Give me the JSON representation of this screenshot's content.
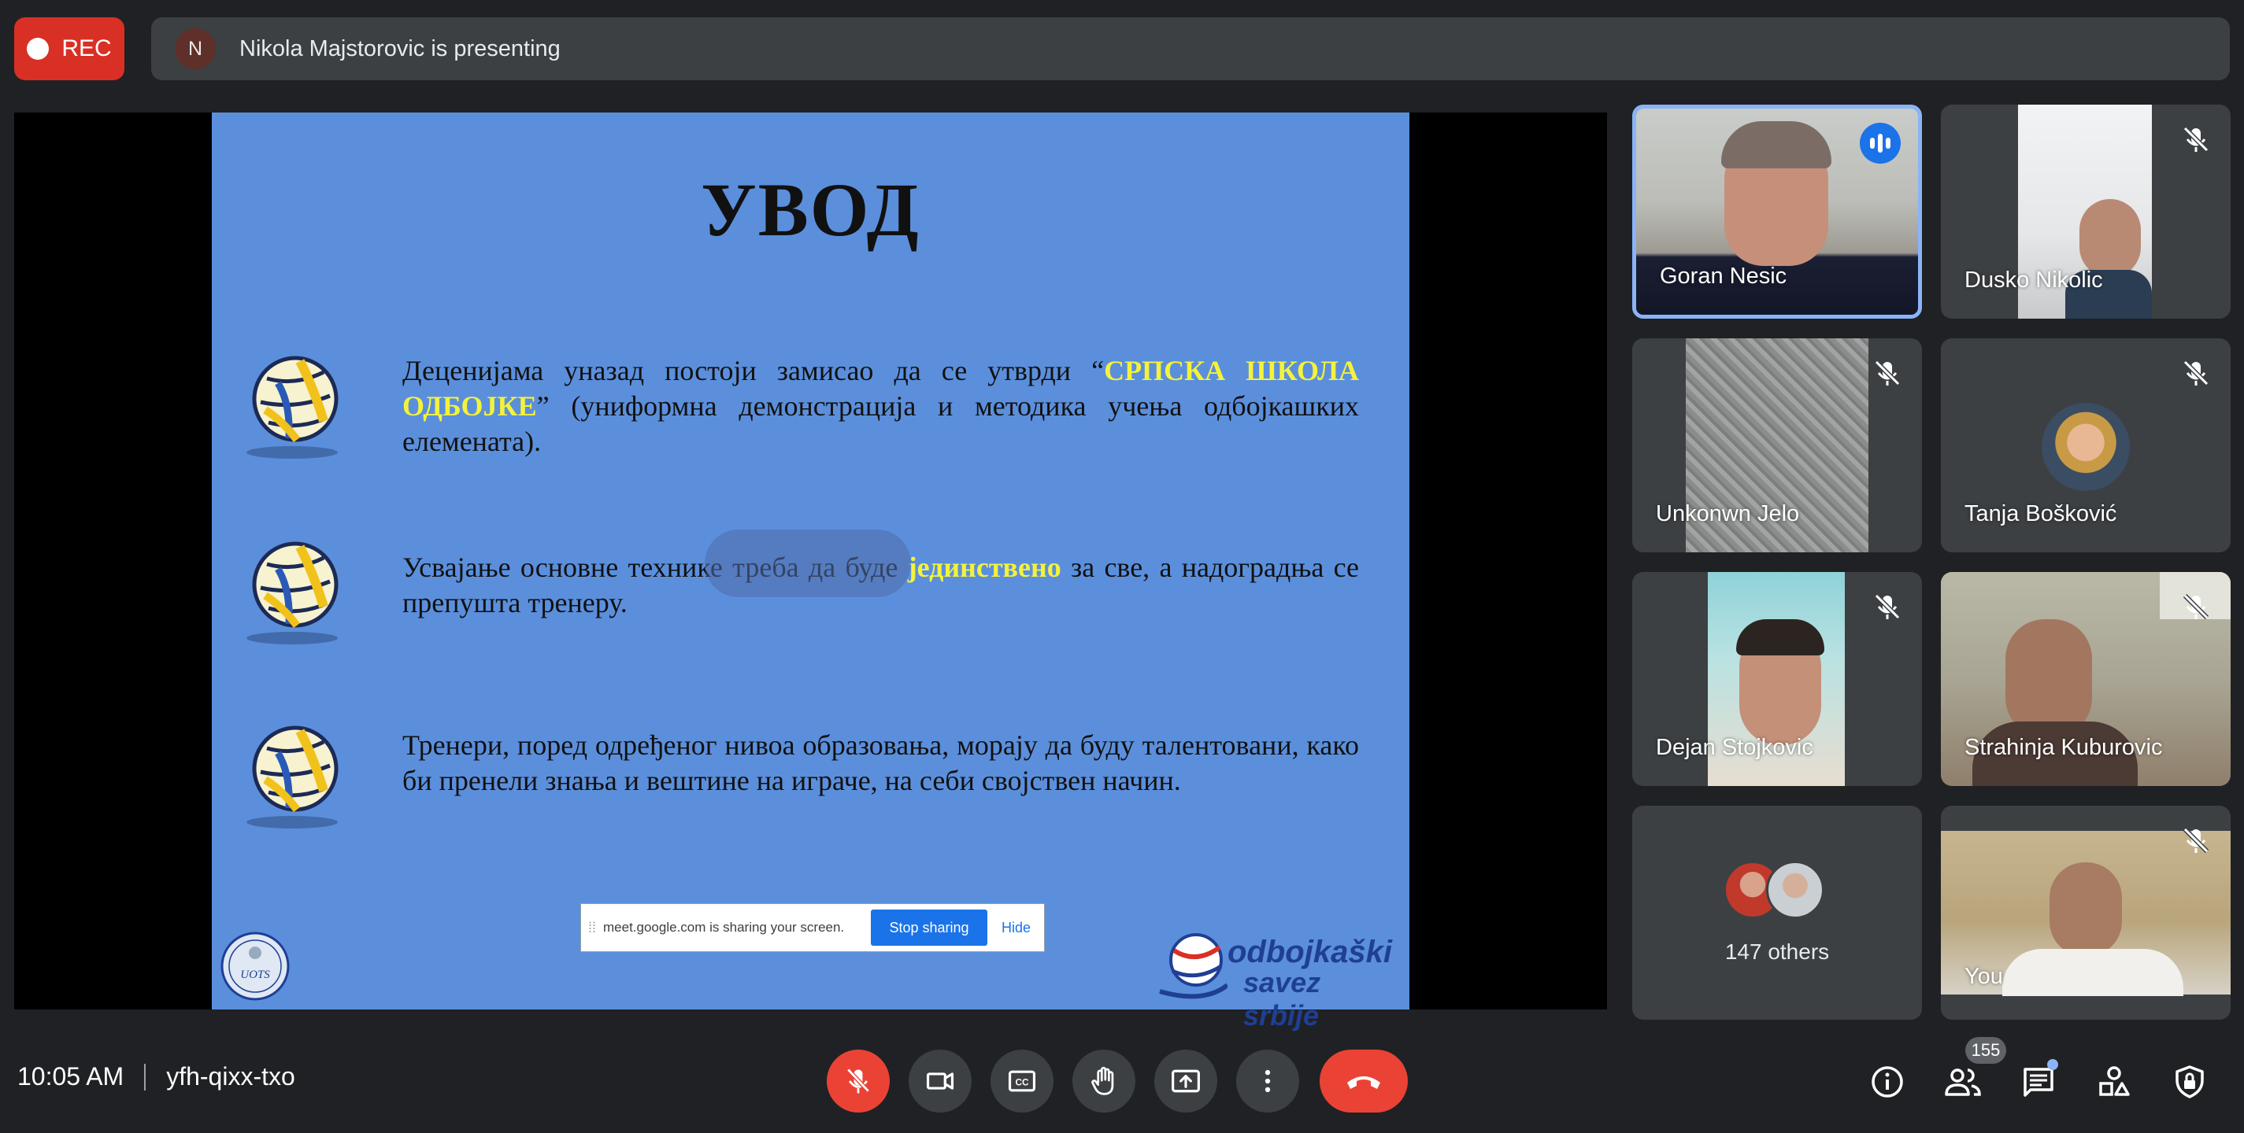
{
  "rec": {
    "label": "REC",
    "color": "#d93025"
  },
  "presenting": {
    "avatar_initial": "N",
    "text": "Nikola Majstorovic is presenting"
  },
  "slide": {
    "title": "УВОД",
    "bullets": [
      {
        "pre": "Деценијама уназад постоји замисао да се утврди “",
        "highlight": "СРПСКА ШКОЛА ОДБОЈКЕ",
        "post": "” (униформна демонстрација и методика учења одбојкашких елемената)."
      },
      {
        "pre": "Усвајање основне технике треба да буде ",
        "highlight": "јединствено",
        "post": " за све, а надоградња се препушта тренеру."
      },
      {
        "pre": "Тренери, поред одређеног нивоа образовања, морају да буду талентовани, како би пренели знања и вештине на играче, на себи својствен начин.",
        "highlight": "",
        "post": ""
      }
    ],
    "sharing_notice": {
      "message": "meet.google.com is sharing your screen.",
      "stop_label": "Stop sharing",
      "hide_label": "Hide"
    },
    "left_logo_text": "UOTS",
    "federation_logo": {
      "line1": "odbojkaški",
      "line2": "savez srbije"
    }
  },
  "participants": [
    {
      "name": "Goran Nesic",
      "speaking": true,
      "muted": false
    },
    {
      "name": "Dusko Nikolic",
      "speaking": false,
      "muted": true
    },
    {
      "name": "Unkonwn Jelo",
      "speaking": false,
      "muted": true
    },
    {
      "name": "Tanja Bošković",
      "speaking": false,
      "muted": true
    },
    {
      "name": "Dejan Stojkovic",
      "speaking": false,
      "muted": true
    },
    {
      "name": "Strahinja Kuburovic",
      "speaking": false,
      "muted": true
    },
    {
      "name": "147 others",
      "speaking": false,
      "muted": false
    },
    {
      "name": "You",
      "speaking": false,
      "muted": true
    }
  ],
  "meeting": {
    "time": "10:05 AM",
    "code": "yfh-qixx-txo"
  },
  "controls": {
    "icons": [
      "mic-off-icon",
      "camera-icon",
      "captions-icon",
      "raise-hand-icon",
      "present-icon",
      "more-options-icon",
      "end-call-icon"
    ],
    "end_call_color": "#ea4335"
  },
  "side_controls": {
    "icons": [
      "info-icon",
      "people-icon",
      "chat-icon",
      "activities-icon",
      "host-controls-icon"
    ],
    "people_count": "155"
  }
}
